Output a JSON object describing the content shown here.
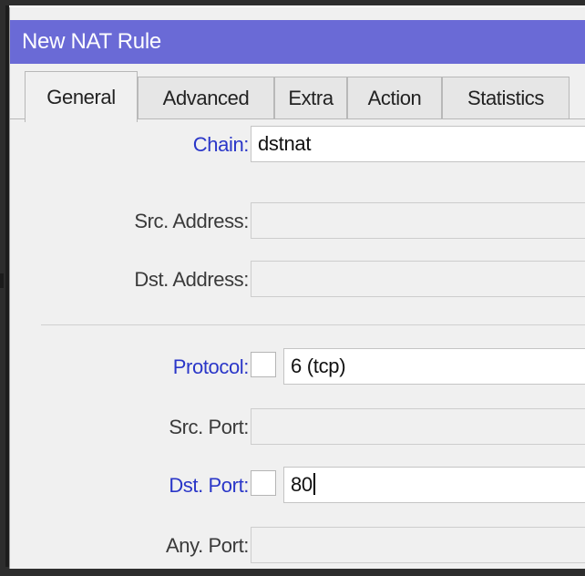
{
  "window": {
    "title": "New NAT Rule"
  },
  "tabs": [
    {
      "label": "General",
      "active": true
    },
    {
      "label": "Advanced",
      "active": false
    },
    {
      "label": "Extra",
      "active": false
    },
    {
      "label": "Action",
      "active": false
    },
    {
      "label": "Statistics",
      "active": false
    }
  ],
  "fields": {
    "chain": {
      "label": "Chain:",
      "value": "dstnat"
    },
    "src_address": {
      "label": "Src. Address:",
      "value": ""
    },
    "dst_address": {
      "label": "Dst. Address:",
      "value": ""
    },
    "protocol": {
      "label": "Protocol:",
      "value": "6 (tcp)",
      "negate_checked": false
    },
    "src_port": {
      "label": "Src. Port:",
      "value": ""
    },
    "dst_port": {
      "label": "Dst. Port:",
      "value": "80",
      "negate_checked": false
    },
    "any_port": {
      "label": "Any. Port:",
      "value": ""
    }
  },
  "colors": {
    "titlebar": "#6a6ad6",
    "label_active": "#2a36c8",
    "label_inactive": "#3a3a3a"
  }
}
